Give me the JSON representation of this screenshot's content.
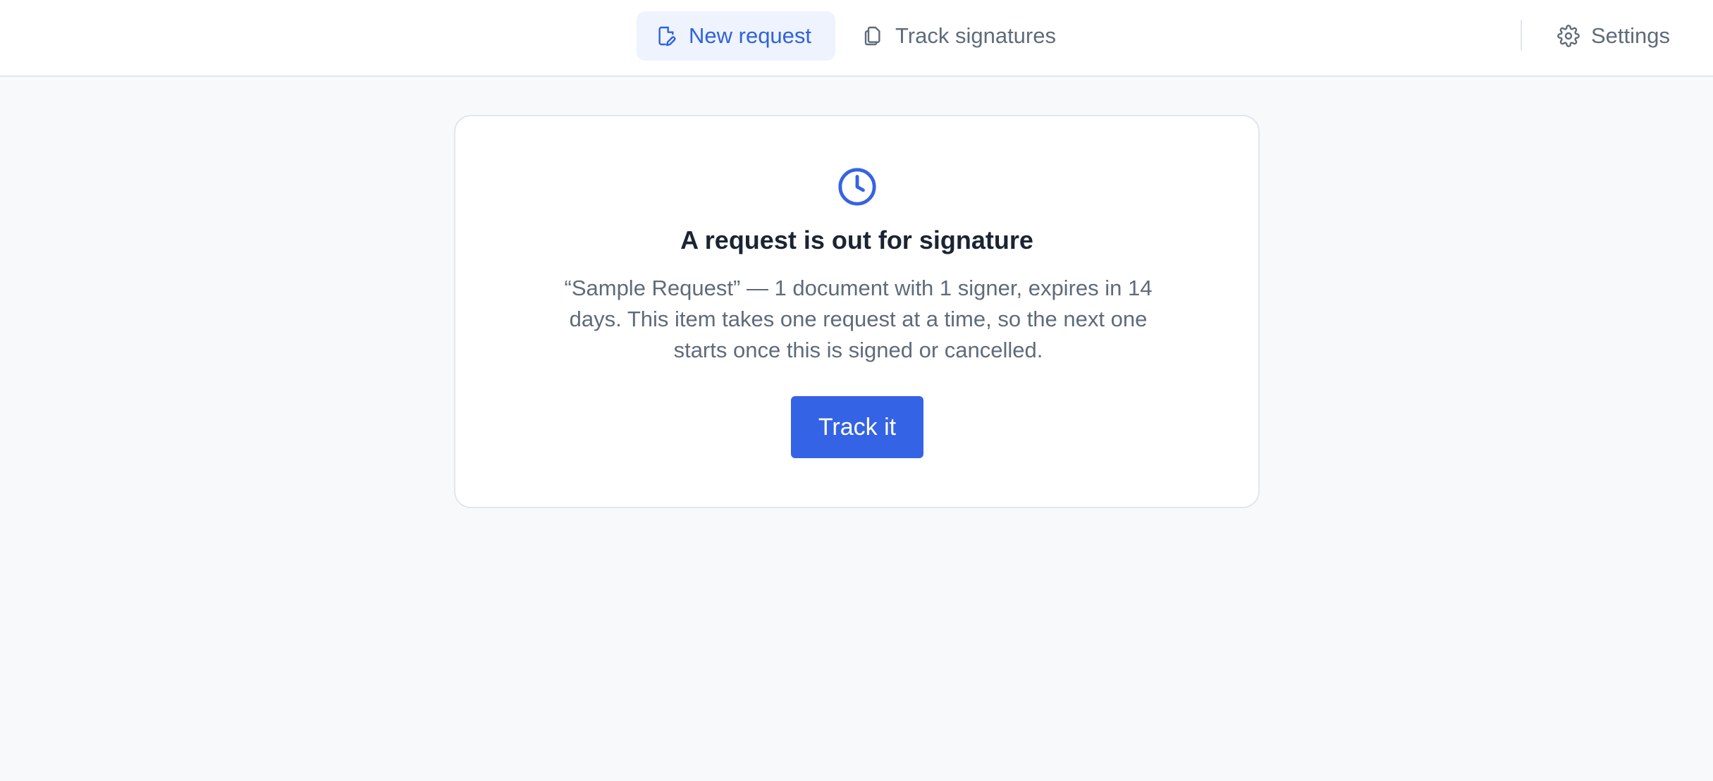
{
  "nav": {
    "tabs": [
      {
        "label": "New request",
        "icon": "document-edit-icon",
        "active": true
      },
      {
        "label": "Track signatures",
        "icon": "documents-icon",
        "active": false
      }
    ],
    "settings": {
      "label": "Settings",
      "icon": "gear-icon"
    }
  },
  "status_card": {
    "icon": "clock-icon",
    "title": "A request is out for signature",
    "description": "“Sample Request” — 1 document with 1 signer, expires in 14 days. This item takes one request at a time, so the next one starts once this is signed or cancelled.",
    "button_label": "Track it"
  },
  "colors": {
    "accent": "#3563e5",
    "active_tab_bg": "#eef3fd",
    "page_bg": "#f8f9fb",
    "text_muted": "#5f6b7a",
    "text_dark": "#1b2433"
  }
}
